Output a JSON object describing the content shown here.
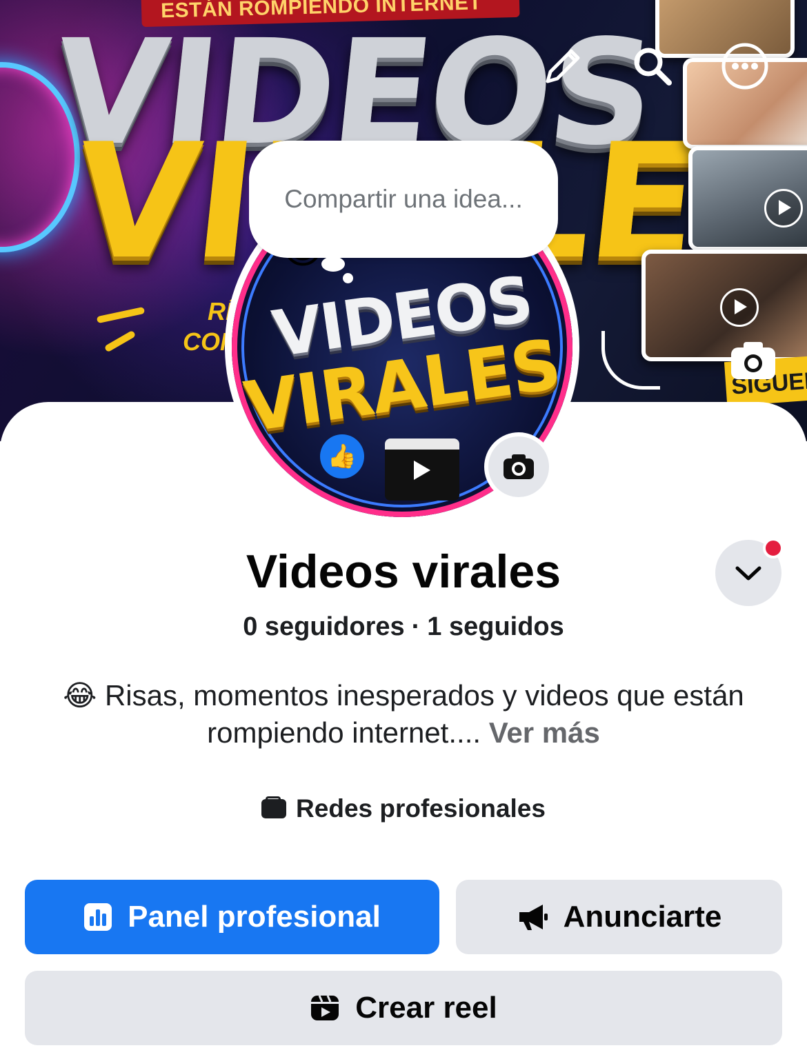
{
  "cover": {
    "banner_text": "ESTÁN ROMPIENDO INTERNET",
    "headline_top": "VIDEOS",
    "headline_bottom": "VIRALES",
    "small_text_1": "RÍ",
    "small_text_2": "CON",
    "side_tag": "SIGUEN"
  },
  "header": {
    "edit_icon": "pencil-icon",
    "search_icon": "search-icon",
    "more_icon": "more-options-icon"
  },
  "idea_bubble": {
    "placeholder": "Compartir una idea..."
  },
  "avatar": {
    "logo_line_1": "VIDEOS",
    "logo_line_2": "VIRALES"
  },
  "profile": {
    "name": "Videos virales",
    "followers": "0 seguidores",
    "separator": "·",
    "following": "1 seguidos",
    "bio_emoji": "😂",
    "bio_text": "Risas, momentos inesperados y videos que están rompiendo internet....",
    "see_more": "Ver más",
    "category": "Redes profesionales"
  },
  "actions": {
    "panel_label": "Panel profesional",
    "ads_label": "Anunciarte",
    "reel_label": "Crear reel"
  },
  "colors": {
    "primary": "#1877f2",
    "secondary_bg": "#e4e6eb",
    "notification": "#e41e3f"
  }
}
